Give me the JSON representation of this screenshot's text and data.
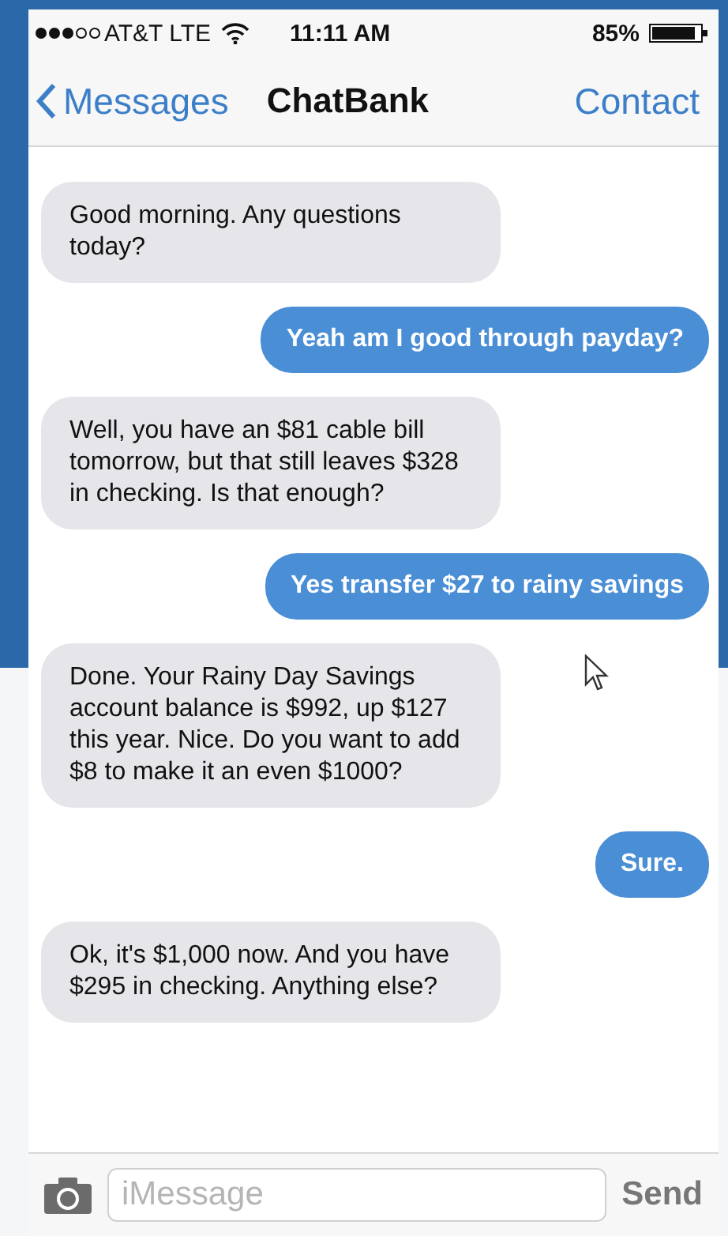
{
  "status_bar": {
    "carrier": "AT&T LTE",
    "time": "11:11 AM",
    "battery": "85%"
  },
  "nav_bar": {
    "back": "Messages",
    "title": "ChatBank",
    "action": "Contact"
  },
  "messages": [
    {
      "kind": "incoming",
      "text": "Good morning. Any questions today?"
    },
    {
      "kind": "outgoing",
      "text": "Yeah am I good through payday?"
    },
    {
      "kind": "incoming",
      "text": "Well, you have an $81 cable bill tomorrow, but that still leaves $328 in checking. Is that enough?"
    },
    {
      "kind": "outgoing",
      "text": "Yes transfer $27 to rainy savings"
    },
    {
      "kind": "incoming",
      "text": "Done. Your Rainy Day Savings account balance is $992, up $127 this year. Nice. Do you want to add $8 to make it an even $1000?"
    },
    {
      "kind": "outgoing",
      "text": "Sure."
    },
    {
      "kind": "incoming",
      "text": "Ok, it's $1,000 now. And you have $295 in checking. Anything else?"
    }
  ],
  "composer": {
    "placeholder": "iMessage",
    "send": "Send"
  }
}
